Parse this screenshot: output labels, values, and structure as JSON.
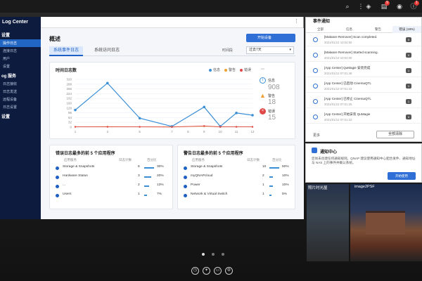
{
  "app": {
    "title": "Log Center",
    "sidebar": {
      "sections": [
        {
          "label": "设置",
          "items": [
            "操作日志",
            "连接日志",
            "用户",
            "设置"
          ]
        },
        {
          "label": "og 服务",
          "items": [
            "日志接收",
            "日志发送",
            "远程设备",
            "日志设置"
          ]
        },
        {
          "label": "设置",
          "items": []
        }
      ],
      "active_item": "操作日志"
    },
    "page_title": "概述",
    "primary_button_label": "开始设备",
    "tabs": [
      "系统事件日志",
      "系统访问日志"
    ],
    "time_label": "时间段",
    "time_select_value": "过去7天",
    "line_chart": {
      "title": "时间日志数",
      "more_icon": "more-icon"
    },
    "stats": [
      {
        "label": "信息",
        "value": "908",
        "icon": "info-icon"
      },
      {
        "label": "警告",
        "value": "18",
        "icon": "warning-icon"
      },
      {
        "label": "错误",
        "value": "15",
        "icon": "error-icon"
      }
    ],
    "top_error_apps": {
      "title": "错误日志最多的前 5 个应用程序",
      "headers": [
        "应用服务",
        "日志计数",
        "百分比"
      ],
      "rows": [
        {
          "name": "Storage & Snapshots",
          "count": "6",
          "pct": "30%"
        },
        {
          "name": "Hardware Status",
          "count": "3",
          "pct": "20%"
        },
        {
          "name": "...",
          "count": "2",
          "pct": "13%"
        },
        {
          "name": "Users",
          "count": "1",
          "pct": "7%"
        }
      ]
    },
    "top_warning_apps": {
      "title": "警告日志最多的前 5 个应用程序",
      "headers": [
        "应用服务",
        "日志计数",
        "百分比"
      ],
      "rows": [
        {
          "name": "Storage & Snapshots",
          "count": "10",
          "pct": "50%"
        },
        {
          "name": "myQNAPcloud",
          "count": "2",
          "pct": "10%"
        },
        {
          "name": "Power",
          "count": "1",
          "pct": "10%"
        },
        {
          "name": "Network & Virtual Switch",
          "count": "1",
          "pct": "5%"
        }
      ]
    }
  },
  "chart_data": {
    "type": "line",
    "title": "时间日志数",
    "x": [
      "1",
      "2",
      "3",
      "4",
      "5",
      "6",
      "7",
      "8",
      "9",
      "10",
      "11",
      "12"
    ],
    "xticks_shown": [
      "1",
      "3",
      "5",
      "7",
      "8",
      "9",
      "10",
      "11",
      "12"
    ],
    "ylim": [
      0,
      320
    ],
    "yticks": [
      0,
      32,
      64,
      96,
      128,
      160,
      192,
      224,
      256,
      288,
      320
    ],
    "series": [
      {
        "name": "信息",
        "color": "#3b8fd6",
        "points": [
          [
            1,
            115
          ],
          [
            3,
            295
          ],
          [
            5,
            60
          ],
          [
            7,
            5
          ],
          [
            9,
            135
          ],
          [
            10,
            5
          ],
          [
            11,
            95
          ],
          [
            12,
            80
          ]
        ]
      },
      {
        "name": "警告",
        "color": "#f0a030",
        "points": [
          [
            1,
            2
          ],
          [
            3,
            3
          ],
          [
            5,
            2
          ],
          [
            7,
            2
          ],
          [
            9,
            6
          ],
          [
            10,
            2
          ],
          [
            11,
            2
          ],
          [
            12,
            2
          ]
        ]
      },
      {
        "name": "错误",
        "color": "#e04848",
        "points": [
          [
            1,
            2
          ],
          [
            3,
            2
          ],
          [
            5,
            2
          ],
          [
            7,
            1
          ],
          [
            9,
            8
          ],
          [
            10,
            2
          ],
          [
            11,
            2
          ],
          [
            12,
            2
          ]
        ]
      }
    ],
    "legend": "top-right",
    "grid": true
  },
  "notifications": {
    "header": "事件通知",
    "tabs": [
      "全部",
      "信息",
      "警告",
      "错误 (19%)"
    ],
    "items": [
      {
        "msg": "[Malware Remover] Scan completed.",
        "time": "2021/01/12 10:04:50",
        "count": "0"
      },
      {
        "msg": "[Malware Remover] Started scanning.",
        "time": "2021/01/12 10:04:00",
        "count": "0"
      },
      {
        "msg": "[App Center] QuMagie 安装完成",
        "time": "2021/01/12 07:01:48",
        "count": "1"
      },
      {
        "msg": "[App Center] 已启动 CinemaQTL",
        "time": "2021/01/12 07:01:43",
        "count": "1"
      },
      {
        "msg": "[App Center] 已停止 CinemaQTL",
        "time": "2021/01/12 07:01:25",
        "count": "1"
      },
      {
        "msg": "[App Center] 开始安装 QuMagie",
        "time": "2021/01/12 07:01:22",
        "count": "0"
      }
    ],
    "more_label": "更多",
    "clear_label": "全部清除"
  },
  "notification_center": {
    "title": "通知中心",
    "body": "您尚未创建任何通知规则。QNAP 建议使用通知中心配合发件、通知地址与 NAS 上的事件并确认系统。",
    "button": "开始使用"
  },
  "wallpaper": {
    "caption1": "照片时光屋",
    "caption2": "image2PSF"
  },
  "system_icons": [
    "search-icon",
    "menu-icon",
    "volume-icon",
    "notification-icon",
    "user-icon",
    "info-icon"
  ],
  "dock": [
    "clock-icon",
    "tools-icon",
    "windows-icon",
    "settings-icon"
  ]
}
